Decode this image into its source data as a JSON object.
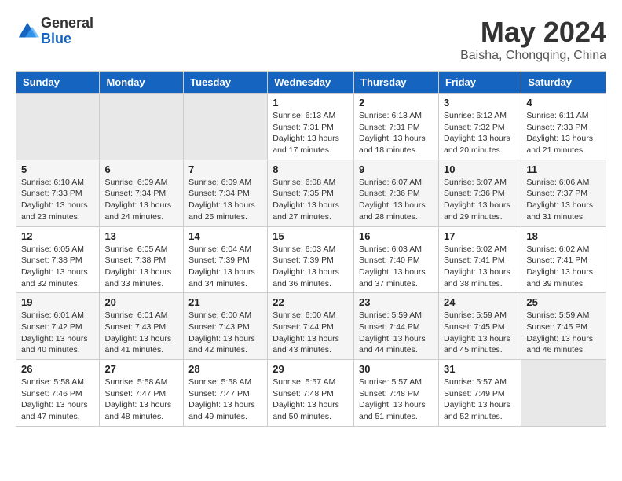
{
  "logo": {
    "general": "General",
    "blue": "Blue"
  },
  "title": "May 2024",
  "subtitle": "Baisha, Chongqing, China",
  "days_of_week": [
    "Sunday",
    "Monday",
    "Tuesday",
    "Wednesday",
    "Thursday",
    "Friday",
    "Saturday"
  ],
  "weeks": [
    [
      {
        "day": "",
        "info": ""
      },
      {
        "day": "",
        "info": ""
      },
      {
        "day": "",
        "info": ""
      },
      {
        "day": "1",
        "info": "Sunrise: 6:13 AM\nSunset: 7:31 PM\nDaylight: 13 hours and 17 minutes."
      },
      {
        "day": "2",
        "info": "Sunrise: 6:13 AM\nSunset: 7:31 PM\nDaylight: 13 hours and 18 minutes."
      },
      {
        "day": "3",
        "info": "Sunrise: 6:12 AM\nSunset: 7:32 PM\nDaylight: 13 hours and 20 minutes."
      },
      {
        "day": "4",
        "info": "Sunrise: 6:11 AM\nSunset: 7:33 PM\nDaylight: 13 hours and 21 minutes."
      }
    ],
    [
      {
        "day": "5",
        "info": "Sunrise: 6:10 AM\nSunset: 7:33 PM\nDaylight: 13 hours and 23 minutes."
      },
      {
        "day": "6",
        "info": "Sunrise: 6:09 AM\nSunset: 7:34 PM\nDaylight: 13 hours and 24 minutes."
      },
      {
        "day": "7",
        "info": "Sunrise: 6:09 AM\nSunset: 7:34 PM\nDaylight: 13 hours and 25 minutes."
      },
      {
        "day": "8",
        "info": "Sunrise: 6:08 AM\nSunset: 7:35 PM\nDaylight: 13 hours and 27 minutes."
      },
      {
        "day": "9",
        "info": "Sunrise: 6:07 AM\nSunset: 7:36 PM\nDaylight: 13 hours and 28 minutes."
      },
      {
        "day": "10",
        "info": "Sunrise: 6:07 AM\nSunset: 7:36 PM\nDaylight: 13 hours and 29 minutes."
      },
      {
        "day": "11",
        "info": "Sunrise: 6:06 AM\nSunset: 7:37 PM\nDaylight: 13 hours and 31 minutes."
      }
    ],
    [
      {
        "day": "12",
        "info": "Sunrise: 6:05 AM\nSunset: 7:38 PM\nDaylight: 13 hours and 32 minutes."
      },
      {
        "day": "13",
        "info": "Sunrise: 6:05 AM\nSunset: 7:38 PM\nDaylight: 13 hours and 33 minutes."
      },
      {
        "day": "14",
        "info": "Sunrise: 6:04 AM\nSunset: 7:39 PM\nDaylight: 13 hours and 34 minutes."
      },
      {
        "day": "15",
        "info": "Sunrise: 6:03 AM\nSunset: 7:39 PM\nDaylight: 13 hours and 36 minutes."
      },
      {
        "day": "16",
        "info": "Sunrise: 6:03 AM\nSunset: 7:40 PM\nDaylight: 13 hours and 37 minutes."
      },
      {
        "day": "17",
        "info": "Sunrise: 6:02 AM\nSunset: 7:41 PM\nDaylight: 13 hours and 38 minutes."
      },
      {
        "day": "18",
        "info": "Sunrise: 6:02 AM\nSunset: 7:41 PM\nDaylight: 13 hours and 39 minutes."
      }
    ],
    [
      {
        "day": "19",
        "info": "Sunrise: 6:01 AM\nSunset: 7:42 PM\nDaylight: 13 hours and 40 minutes."
      },
      {
        "day": "20",
        "info": "Sunrise: 6:01 AM\nSunset: 7:43 PM\nDaylight: 13 hours and 41 minutes."
      },
      {
        "day": "21",
        "info": "Sunrise: 6:00 AM\nSunset: 7:43 PM\nDaylight: 13 hours and 42 minutes."
      },
      {
        "day": "22",
        "info": "Sunrise: 6:00 AM\nSunset: 7:44 PM\nDaylight: 13 hours and 43 minutes."
      },
      {
        "day": "23",
        "info": "Sunrise: 5:59 AM\nSunset: 7:44 PM\nDaylight: 13 hours and 44 minutes."
      },
      {
        "day": "24",
        "info": "Sunrise: 5:59 AM\nSunset: 7:45 PM\nDaylight: 13 hours and 45 minutes."
      },
      {
        "day": "25",
        "info": "Sunrise: 5:59 AM\nSunset: 7:45 PM\nDaylight: 13 hours and 46 minutes."
      }
    ],
    [
      {
        "day": "26",
        "info": "Sunrise: 5:58 AM\nSunset: 7:46 PM\nDaylight: 13 hours and 47 minutes."
      },
      {
        "day": "27",
        "info": "Sunrise: 5:58 AM\nSunset: 7:47 PM\nDaylight: 13 hours and 48 minutes."
      },
      {
        "day": "28",
        "info": "Sunrise: 5:58 AM\nSunset: 7:47 PM\nDaylight: 13 hours and 49 minutes."
      },
      {
        "day": "29",
        "info": "Sunrise: 5:57 AM\nSunset: 7:48 PM\nDaylight: 13 hours and 50 minutes."
      },
      {
        "day": "30",
        "info": "Sunrise: 5:57 AM\nSunset: 7:48 PM\nDaylight: 13 hours and 51 minutes."
      },
      {
        "day": "31",
        "info": "Sunrise: 5:57 AM\nSunset: 7:49 PM\nDaylight: 13 hours and 52 minutes."
      },
      {
        "day": "",
        "info": ""
      }
    ]
  ]
}
